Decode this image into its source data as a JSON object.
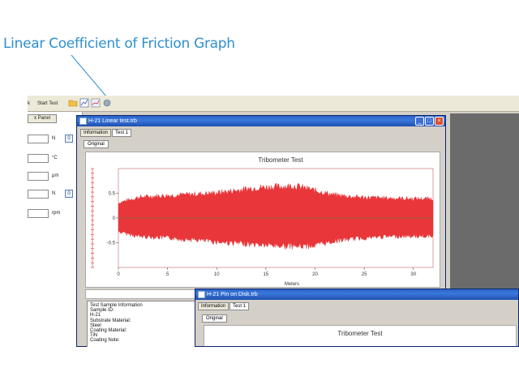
{
  "callout": {
    "text": "Linear Coefficient of Friction Graph"
  },
  "toolbar": {
    "item1": "k",
    "item2": "Start Test"
  },
  "left_panel": {
    "button": "x Panel",
    "rows": [
      {
        "unit": "N",
        "check": "0"
      },
      {
        "unit": "°C",
        "check": ""
      },
      {
        "unit": "μm",
        "check": ""
      },
      {
        "unit": "N",
        "check": "0"
      },
      {
        "unit": "rpm",
        "check": ""
      }
    ]
  },
  "window1": {
    "title": "H-21 Linear test.trb",
    "tabs": [
      "Information",
      "Test 1"
    ],
    "subtab": "Original",
    "info_lines": [
      "Test Sample Information",
      "Sample ID:",
      "H-21",
      "Substrate Material:",
      "Steel",
      "Coating Material:",
      "TiN",
      "Coating Note:"
    ]
  },
  "window2": {
    "title": "H-21 Pin on Disk.trb",
    "tabs": [
      "Information",
      "Test 1"
    ],
    "subtab": "Original",
    "chart_title": "Tribometer Test"
  },
  "chart_data": {
    "type": "area",
    "title": "Tribometer Test",
    "xlabel": "Meters",
    "ylabel": "",
    "xlim": [
      0,
      32
    ],
    "ylim": [
      -1.0,
      1.0
    ],
    "x_ticks": [
      "0",
      "5",
      "10",
      "15",
      "20",
      "25",
      "30"
    ],
    "y_ticks": [
      "0.5",
      "0",
      "-0.5"
    ],
    "series": [
      {
        "color": "#e8363a",
        "x": [
          0,
          2,
          4,
          6,
          8,
          10,
          12,
          14,
          16,
          18,
          20,
          22,
          24,
          26,
          28,
          30,
          32
        ],
        "upper": [
          0.33,
          0.45,
          0.48,
          0.5,
          0.52,
          0.55,
          0.6,
          0.66,
          0.68,
          0.7,
          0.6,
          0.5,
          0.46,
          0.44,
          0.43,
          0.42,
          0.42
        ],
        "lower": [
          -0.3,
          -0.4,
          -0.42,
          -0.45,
          -0.48,
          -0.52,
          -0.55,
          -0.58,
          -0.6,
          -0.62,
          -0.6,
          -0.5,
          -0.45,
          -0.42,
          -0.4,
          -0.4,
          -0.38
        ]
      }
    ],
    "zero_line_color": "#8b6a3a"
  }
}
